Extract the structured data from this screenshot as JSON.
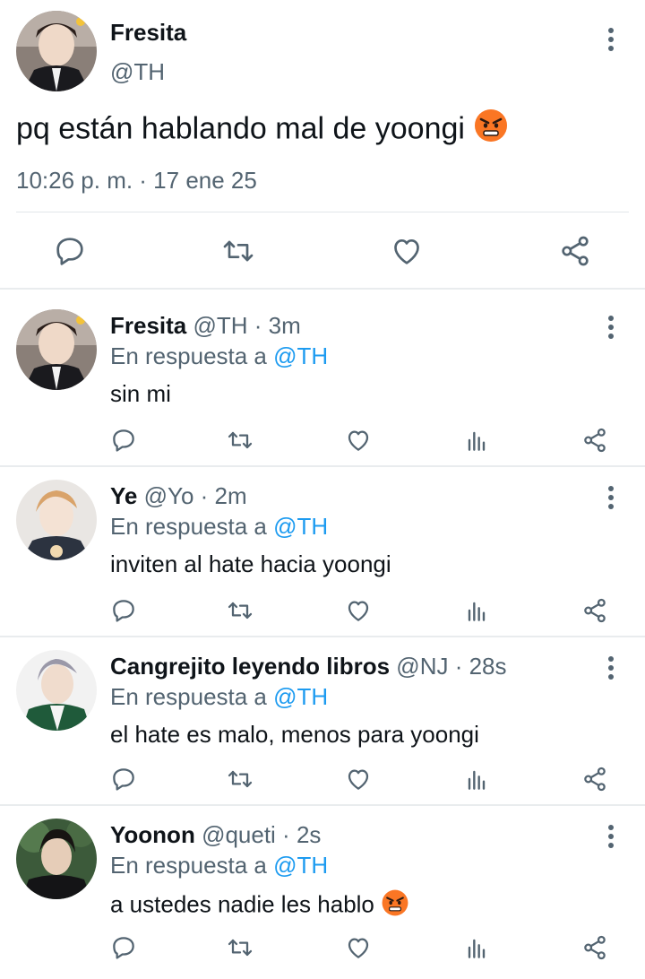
{
  "main_tweet": {
    "display_name": "Fresita",
    "handle": "@TH",
    "text": "pq están hablando mal de yoongi",
    "emoji_icon": "angry-face-emoji",
    "timestamp": "10:26 p. m. · 17 ene 25",
    "actions": [
      "reply-icon",
      "retweet-icon",
      "like-icon",
      "share-icon"
    ]
  },
  "replies": [
    {
      "display_name": "Fresita",
      "meta": "@TH · 3m",
      "in_reply_label": "En respuesta a",
      "in_reply_handle": "@TH",
      "text": "sin mi"
    },
    {
      "display_name": "Ye",
      "meta": "@Yo · 2m",
      "in_reply_label": "En respuesta a",
      "in_reply_handle": "@TH",
      "text": "inviten al hate hacia yoongi"
    },
    {
      "display_name": "Cangrejito leyendo libros",
      "meta": "@NJ · 28s",
      "in_reply_label": "En respuesta a",
      "in_reply_handle": "@TH",
      "text": "el hate es malo, menos para yoongi"
    },
    {
      "display_name": "Yoonon",
      "meta": "@queti · 2s",
      "in_reply_label": "En respuesta a",
      "in_reply_handle": "@TH",
      "text": "a ustedes nadie les hablo",
      "emoji_icon": "angry-face-emoji"
    }
  ],
  "colors": {
    "text": "#0f1419",
    "secondary": "#536471",
    "mention": "#1d9bf0",
    "divider": "#e1e6ea"
  }
}
